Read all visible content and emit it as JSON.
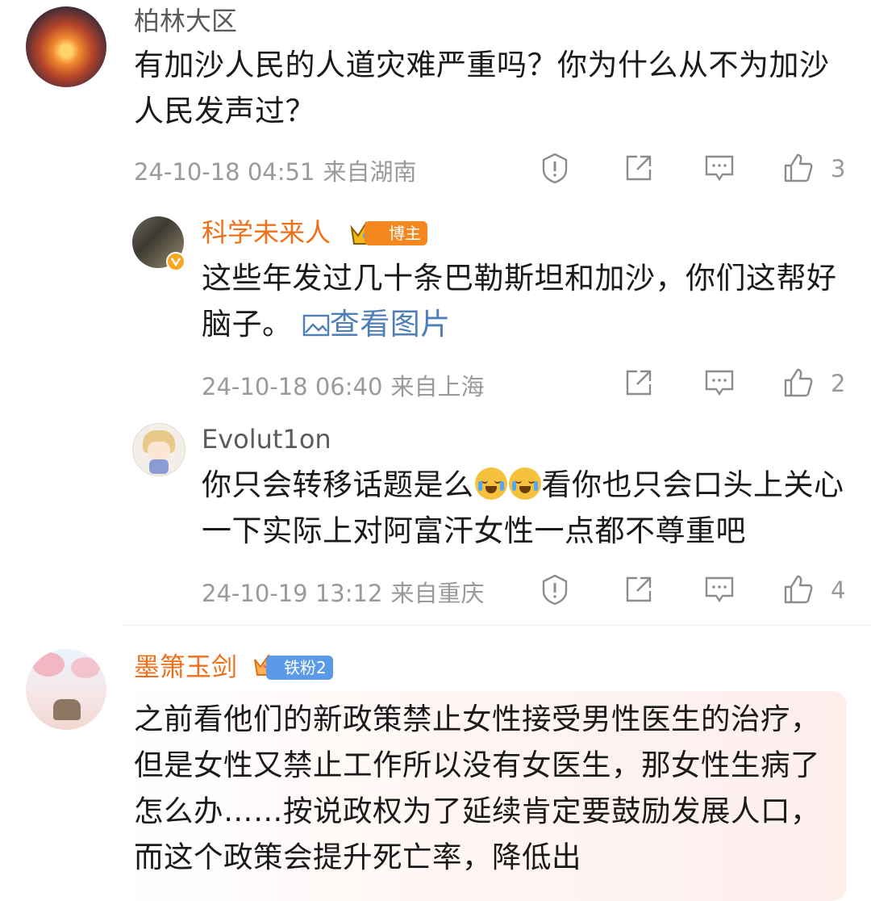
{
  "comments": [
    {
      "username": "柏林大区",
      "content": "有加沙人民的人道灾难严重吗？你为什么从不为加沙人民发声过？",
      "date": "24-10-18 04:51",
      "location": "来自湖南",
      "likes": "3"
    },
    {
      "username": "科学未来人",
      "badge": "博主",
      "content": "这些年发过几十条巴勒斯坦和加沙，你们这帮好脑子。",
      "link_text": "查看图片",
      "date": "24-10-18 06:40",
      "location": "来自上海",
      "likes": "2"
    },
    {
      "username": "Evolut1on",
      "content_a": "你只会转移话题是么",
      "content_b": "看你也只会口头上关心一下实际上对阿富汗女性一点都不尊重吧",
      "date": "24-10-19 13:12",
      "location": "来自重庆",
      "likes": "4"
    },
    {
      "username": "墨箫玉剑",
      "badge": "铁粉2",
      "content": "之前看他们的新政策禁止女性接受男性医生的治疗，但是女性又禁止工作所以没有女医生，那女性生病了怎么办……按说政权为了延续肯定要鼓励发展人口，而这个政策会提升死亡率，降低出"
    }
  ],
  "icons": {
    "report": "warning-shield-icon",
    "share": "share-icon",
    "comment": "comment-icon",
    "like": "thumbs-up-icon"
  }
}
